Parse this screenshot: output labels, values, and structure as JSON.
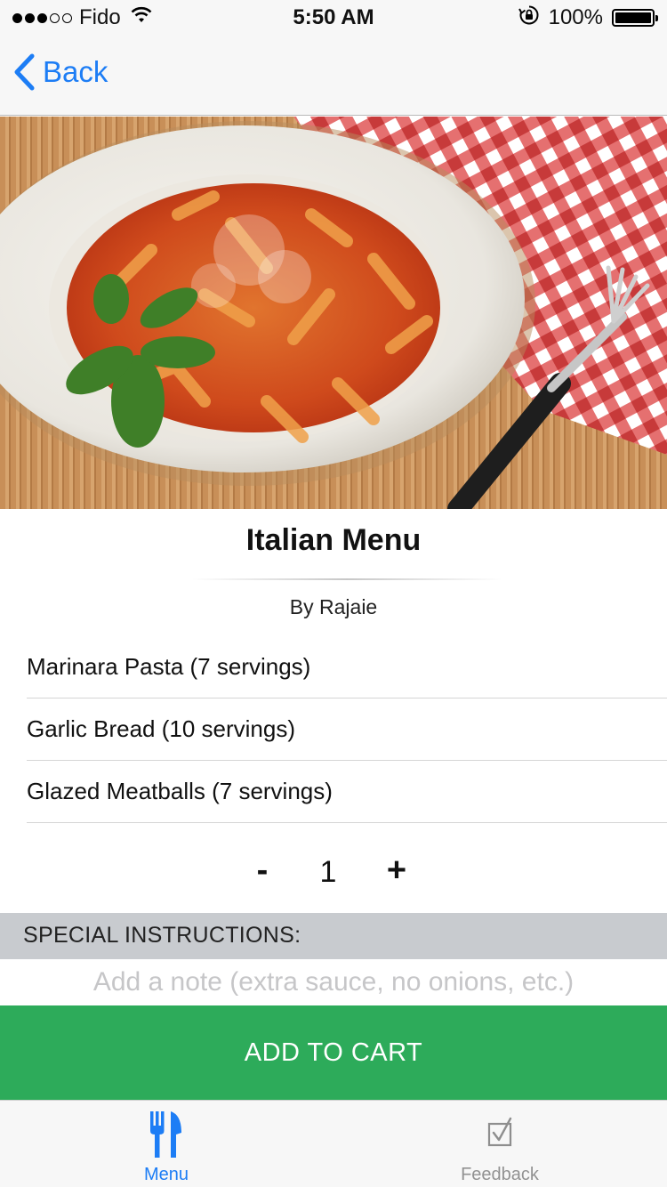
{
  "status_bar": {
    "carrier": "Fido",
    "time": "5:50 AM",
    "battery": "100%",
    "signal_bars_filled": 3,
    "signal_bars_total": 5
  },
  "nav": {
    "back_label": "Back"
  },
  "hero": {
    "image_subject": "plate of penne pasta with marinara sauce, parmesan and basil"
  },
  "menu": {
    "title": "Italian Menu",
    "author": "By Rajaie",
    "items": [
      {
        "label": "Marinara Pasta  (7 servings)"
      },
      {
        "label": "Garlic Bread  (10 servings)"
      },
      {
        "label": "Glazed Meatballs  (7 servings)"
      }
    ]
  },
  "stepper": {
    "minus": "-",
    "quantity": "1",
    "plus": "+"
  },
  "instructions": {
    "label": "SPECIAL INSTRUCTIONS:",
    "placeholder": "Add a note (extra sauce, no onions, etc.)"
  },
  "cart": {
    "button_label": "ADD TO CART"
  },
  "tabs": [
    {
      "label": "Menu",
      "icon": "fork-knife-icon",
      "active": true
    },
    {
      "label": "Feedback",
      "icon": "checkbox-icon",
      "active": false
    }
  ],
  "colors": {
    "accent": "#1d7df5",
    "cart_green": "#2dab5a",
    "instructions_bg": "#c8cbcf"
  }
}
